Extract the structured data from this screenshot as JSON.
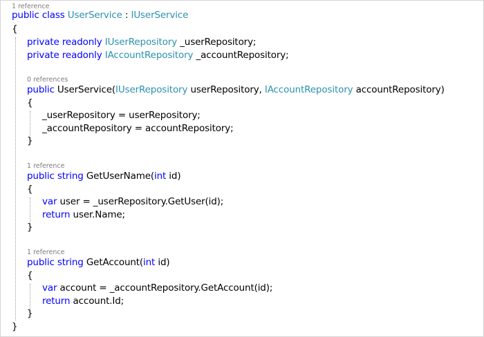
{
  "colors": {
    "keyword": "#0000ff",
    "type": "#2b91af",
    "text": "#000000",
    "codelens": "#7a7a7a",
    "guide": "#9a9a9a"
  },
  "code": {
    "class_lens": "1 reference",
    "class_kw": "public class",
    "class_name": "UserService",
    "class_colon": " : ",
    "class_iface": "IUserService",
    "open_brace": "{",
    "close_brace": "}",
    "field1_kw": "private readonly",
    "field1_type": "IUserRepository",
    "field1_name": " _userRepository;",
    "field2_kw": "private readonly",
    "field2_type": "IAccountRepository",
    "field2_name": " _accountRepository;",
    "ctor_lens": "0 references",
    "ctor_kw": "public",
    "ctor_name": " UserService(",
    "ctor_p1_type": "IUserRepository",
    "ctor_p1_name": " userRepository, ",
    "ctor_p2_type": "IAccountRepository",
    "ctor_p2_name": " accountRepository)",
    "ctor_open": "{",
    "ctor_stmt1": "_userRepository = userRepository;",
    "ctor_stmt2": "_accountRepository = accountRepository;",
    "ctor_close": "}",
    "m1_lens": "1 reference",
    "m1_kw": "public string",
    "m1_name": " GetUserName(",
    "m1_int": "int",
    "m1_param": " id)",
    "m1_open": "{",
    "m1_var": "var",
    "m1_stmt1": " user = _userRepository.GetUser(id);",
    "m1_return": "return",
    "m1_stmt2": " user.Name;",
    "m1_close": "}",
    "m2_lens": "1 reference",
    "m2_kw": "public string",
    "m2_name": " GetAccount(",
    "m2_int": "int",
    "m2_param": " id)",
    "m2_open": "{",
    "m2_var": "var",
    "m2_stmt1": " account = _accountRepository.GetAccount(id);",
    "m2_return": "return",
    "m2_stmt2": " account.Id;",
    "m2_close": "}"
  }
}
